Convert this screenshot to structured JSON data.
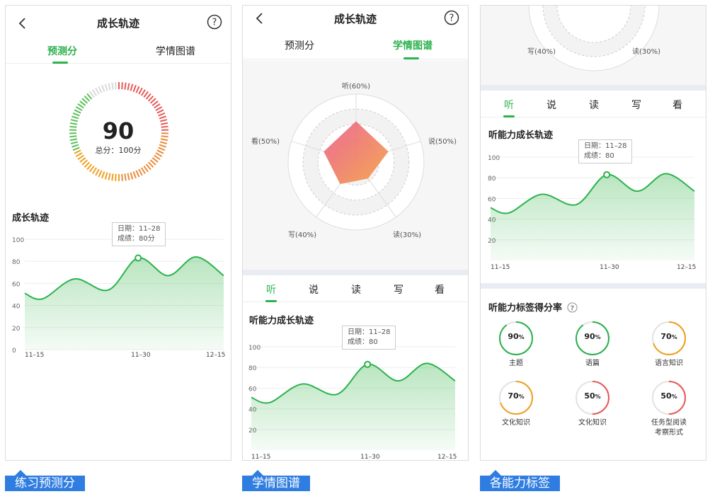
{
  "colors": {
    "accent": "#2bb24c",
    "caption": "#2f7de1",
    "low": "#e75a5a",
    "mid": "#f0a020"
  },
  "header": {
    "title": "成长轨迹"
  },
  "icons": {
    "back": "chevron-left-icon",
    "help": "question-circle-icon"
  },
  "tabs": [
    "预测分",
    "学情图谱"
  ],
  "panel1": {
    "active_tab": 0,
    "score": "90",
    "total_label": "总分：100分",
    "score_ratio": 0.9,
    "section_title": "成长轨迹",
    "tooltip": {
      "date": "日期：11–28",
      "value": "成绩：80分"
    }
  },
  "panel2": {
    "active_tab": 1,
    "radar_labels": {
      "listen": "听(60%)",
      "speak": "说(50%)",
      "read": "读(30%)",
      "write": "写(40%)",
      "look": "看(50%)"
    },
    "radar_values": [
      60,
      50,
      30,
      40,
      50
    ],
    "skill_tabs": [
      "听",
      "说",
      "读",
      "写",
      "看"
    ],
    "active_skill": 0,
    "section_title": "听能力成长轨迹",
    "tooltip": {
      "date": "日期：11–28",
      "value": "成绩：80"
    }
  },
  "panel3": {
    "radar_labels": {
      "write": "写(40%)",
      "read": "读(30%)"
    },
    "skill_tabs": [
      "听",
      "说",
      "读",
      "写",
      "看"
    ],
    "active_skill": 0,
    "section_title": "听能力成长轨迹",
    "tooltip": {
      "date": "日期：11–28",
      "value": "成绩：80"
    },
    "tags_title": "听能力标签得分率",
    "tags": [
      {
        "label": "主题",
        "value": "90",
        "unit": "%",
        "percent": 90,
        "color": "#2bb24c"
      },
      {
        "label": "语篇",
        "value": "90",
        "unit": "%",
        "percent": 90,
        "color": "#2bb24c"
      },
      {
        "label": "语言知识",
        "value": "70",
        "unit": "%",
        "percent": 70,
        "color": "#f0a020"
      },
      {
        "label": "文化知识",
        "value": "70",
        "unit": "%",
        "percent": 70,
        "color": "#f0a020"
      },
      {
        "label": "文化知识",
        "value": "50",
        "unit": "%",
        "percent": 50,
        "color": "#e75a5a"
      },
      {
        "label": "任务型阅读\n考察形式",
        "value": "50",
        "unit": "%",
        "percent": 50,
        "color": "#e75a5a"
      }
    ]
  },
  "chart_data": [
    {
      "type": "area",
      "title": "成长轨迹",
      "x_ticks": [
        "11–15",
        "11–30",
        "12–15"
      ],
      "y_ticks": [
        "0",
        "20",
        "40",
        "60",
        "80",
        "100"
      ],
      "ylim": [
        0,
        100
      ],
      "x": [
        0,
        0.09,
        0.25,
        0.42,
        0.57,
        0.72,
        0.86,
        1.0
      ],
      "values": [
        51,
        46,
        64,
        54,
        83,
        67,
        84,
        67
      ],
      "highlight_index": 4
    },
    {
      "type": "area",
      "title": "听能力成长轨迹",
      "x_ticks": [
        "11–15",
        "11–30",
        "12–15"
      ],
      "y_ticks": [
        "20",
        "40",
        "60",
        "80",
        "100"
      ],
      "ylim": [
        0,
        100
      ],
      "x": [
        0,
        0.09,
        0.25,
        0.42,
        0.57,
        0.72,
        0.86,
        1.0
      ],
      "values": [
        51,
        46,
        64,
        54,
        83,
        67,
        84,
        67
      ],
      "highlight_index": 4
    },
    {
      "type": "area",
      "title": "听能力成长轨迹",
      "x_ticks": [
        "11–15",
        "11–30",
        "12–15"
      ],
      "y_ticks": [
        "20",
        "40",
        "60",
        "80",
        "100"
      ],
      "ylim": [
        0,
        100
      ],
      "x": [
        0,
        0.09,
        0.25,
        0.42,
        0.57,
        0.72,
        0.86,
        1.0
      ],
      "values": [
        51,
        46,
        64,
        54,
        83,
        67,
        84,
        67
      ],
      "highlight_index": 4
    }
  ],
  "captions": [
    "练习预测分",
    "学情图谱",
    "各能力标签"
  ]
}
